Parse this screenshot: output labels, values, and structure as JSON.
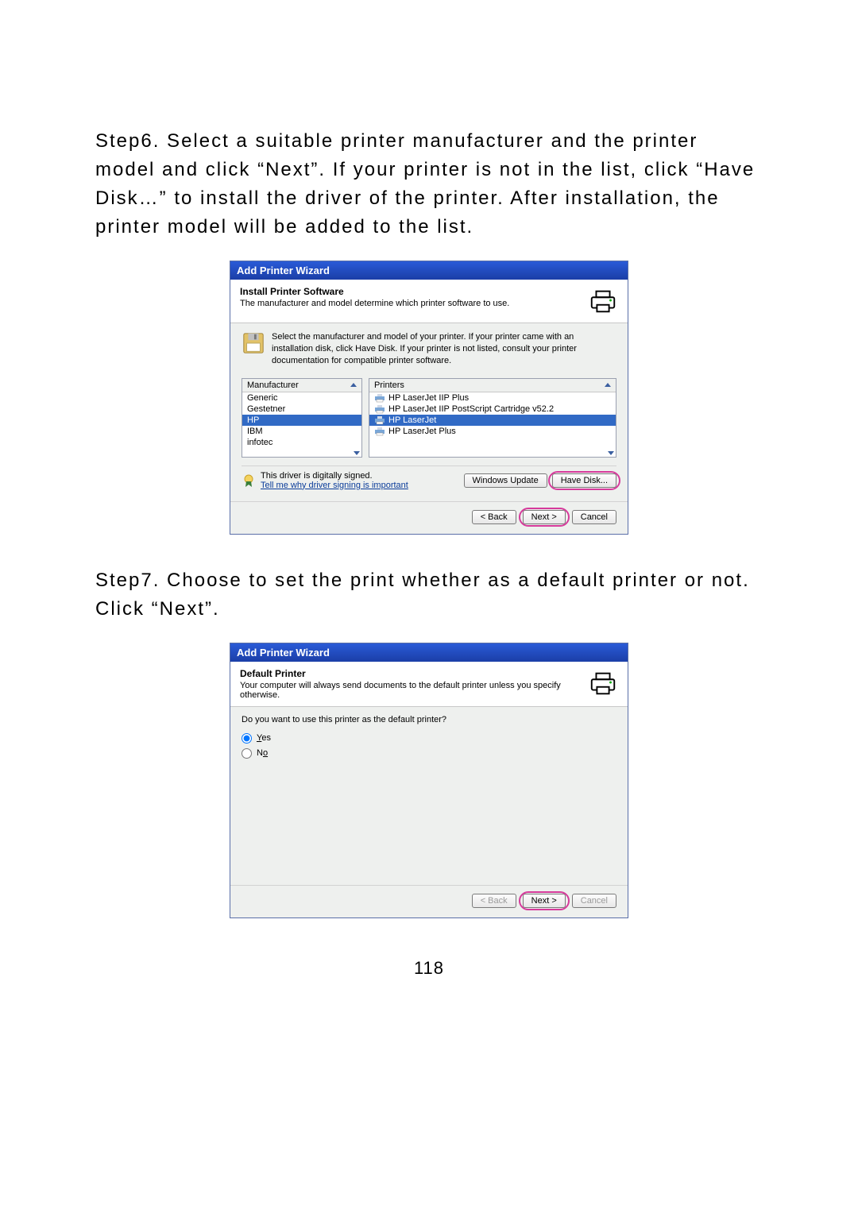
{
  "page_number": "118",
  "step6_text": "Step6.   Select a suitable printer manufacturer and the printer model and click “Next”. If your printer is not in the list, click “Have Disk…” to install the driver of the printer. After installation, the printer model will be added to the list.",
  "step7_text": "Step7.   Choose to set the print whether as a default printer or not. Click “Next”.",
  "dialog1": {
    "title": "Add Printer Wizard",
    "header_title": "Install Printer Software",
    "header_sub": "The manufacturer and model determine which printer software to use.",
    "info_text": "Select the manufacturer and model of your printer. If your printer came with an installation disk, click Have Disk. If your printer is not listed, consult your printer documentation for compatible printer software.",
    "mfg_label": "Manufacturer",
    "prn_label": "Printers",
    "manufacturers": [
      "Generic",
      "Gestetner",
      "HP",
      "IBM",
      "infotec"
    ],
    "selected_mfg": "HP",
    "printers": [
      "HP LaserJet IIP Plus",
      "HP LaserJet IIP PostScript Cartridge v52.2",
      "HP LaserJet",
      "HP LaserJet Plus"
    ],
    "selected_printer": "HP LaserJet",
    "signed_text": "This driver is digitally signed.",
    "signed_link": "Tell me why driver signing is important",
    "win_update": "Windows Update",
    "have_disk": "Have Disk...",
    "back": "< Back",
    "next": "Next >",
    "cancel": "Cancel"
  },
  "dialog2": {
    "title": "Add Printer Wizard",
    "header_title": "Default Printer",
    "header_sub": "Your computer will always send documents to the default printer unless you specify otherwise.",
    "question": "Do you want to use this printer as the default printer?",
    "opt_yes": "Yes",
    "opt_no": "No",
    "back": "< Back",
    "next": "Next >",
    "cancel": "Cancel"
  }
}
